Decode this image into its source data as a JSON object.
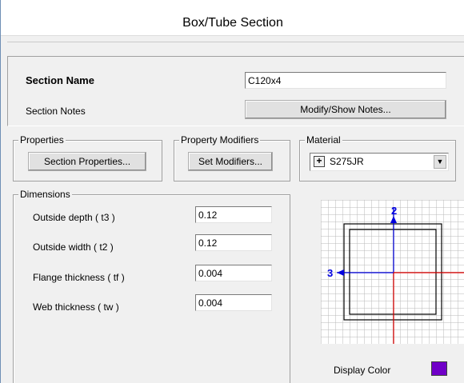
{
  "window": {
    "title": "Box/Tube Section"
  },
  "section": {
    "name_label": "Section Name",
    "name_value": "C120x4",
    "notes_label": "Section Notes",
    "notes_button": "Modify/Show Notes..."
  },
  "properties": {
    "group_label": "Properties",
    "button": "Section Properties..."
  },
  "modifiers": {
    "group_label": "Property Modifiers",
    "button": "Set Modifiers..."
  },
  "material": {
    "group_label": "Material",
    "plus_symbol": "+",
    "selected": "S275JR",
    "dropdown_arrow": "▼"
  },
  "dimensions": {
    "group_label": "Dimensions",
    "fields": [
      {
        "label": "Outside depth  ( t3 )",
        "value": "0.12"
      },
      {
        "label": "Outside width  ( t2 )",
        "value": "0.12"
      },
      {
        "label": "Flange thickness  ( tf )",
        "value": "0.004"
      },
      {
        "label": "Web thickness  ( tw )",
        "value": "0.004"
      }
    ]
  },
  "preview": {
    "axis_vertical_label": "2",
    "axis_horizontal_label": "3"
  },
  "display_color": {
    "label": "Display Color",
    "color": "#7000c8"
  }
}
